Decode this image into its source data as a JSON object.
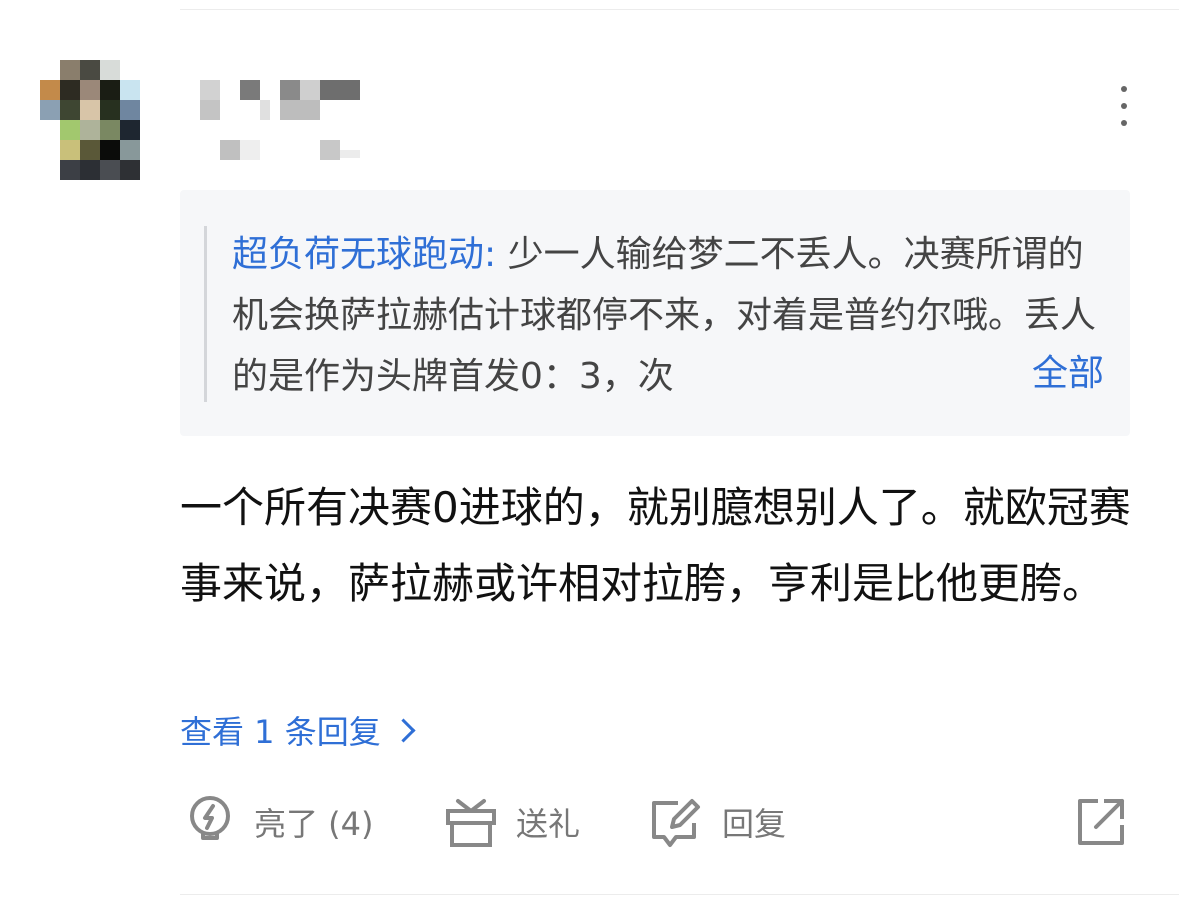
{
  "quote": {
    "author": "超负荷无球跑动:",
    "text": " 少一人输给梦二不丢人。决赛所谓的机会换萨拉赫估计球都停不来，对着是普约尔哦。丢人的是作为头牌首发0：3，次",
    "expand_label": "全部"
  },
  "comment": {
    "text": "一个所有决赛0进球的，就别臆想别人了。就欧冠赛事来说，萨拉赫或许相对拉胯，亨利是比他更胯。"
  },
  "replies": {
    "label": "查看 1 条回复"
  },
  "actions": {
    "like_label": "亮了 (4)",
    "gift_label": "送礼",
    "reply_label": "回复"
  },
  "icons": [
    "more-vertical-icon",
    "lightbulb-icon",
    "gift-icon",
    "edit-reply-icon",
    "share-icon"
  ],
  "colors": {
    "link": "#2f6fd6",
    "quote_bg": "#f6f7f9",
    "text": "#111111",
    "muted": "#777777"
  }
}
